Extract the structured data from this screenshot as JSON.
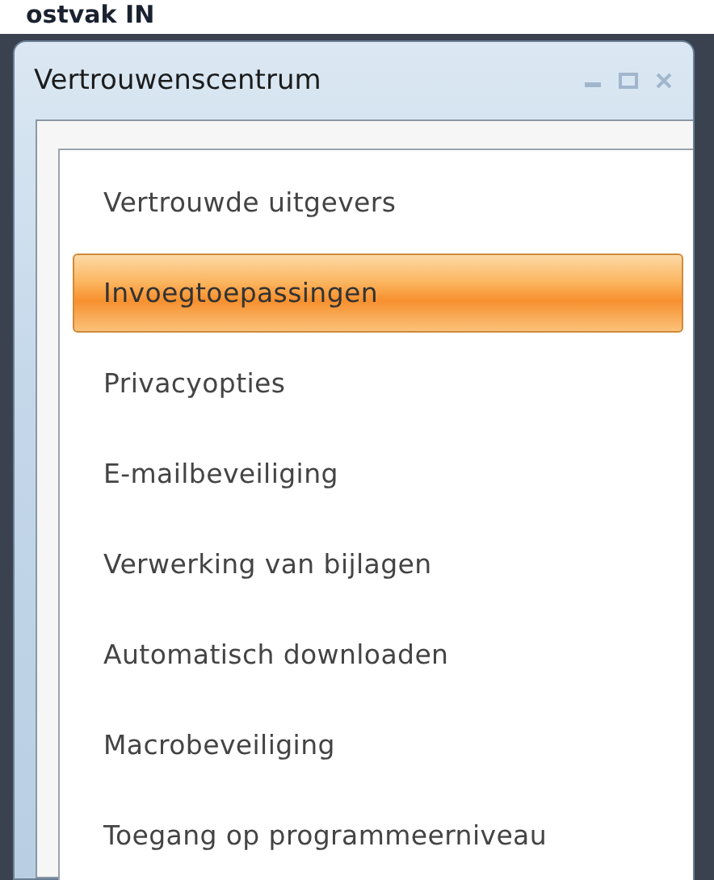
{
  "background_window": {
    "title": "ostvak IN"
  },
  "window": {
    "title": "Vertrouwenscentrum"
  },
  "nav": {
    "items": [
      {
        "label": "Vertrouwde uitgevers",
        "selected": false
      },
      {
        "label": "Invoegtoepassingen",
        "selected": true
      },
      {
        "label": "Privacyopties",
        "selected": false
      },
      {
        "label": "E-mailbeveiliging",
        "selected": false
      },
      {
        "label": "Verwerking van bijlagen",
        "selected": false
      },
      {
        "label": "Automatisch downloaden",
        "selected": false
      },
      {
        "label": "Macrobeveiliging",
        "selected": false
      },
      {
        "label": "Toegang op programmeerniveau",
        "selected": false
      }
    ]
  }
}
